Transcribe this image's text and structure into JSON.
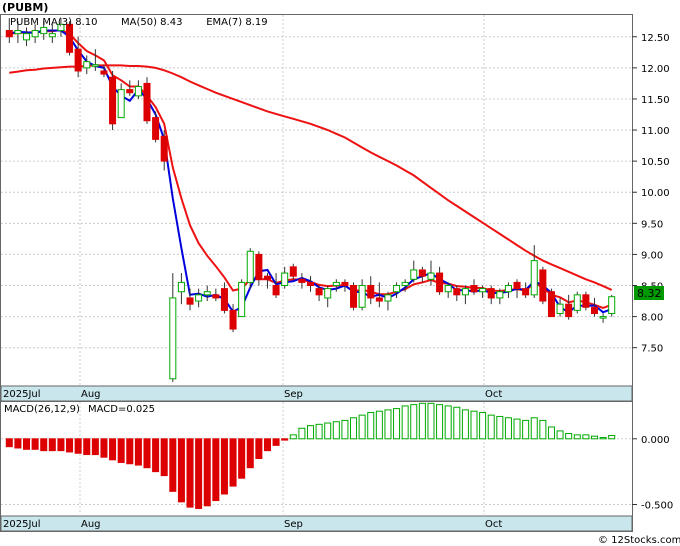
{
  "ticker_label": "(PUBM)",
  "indicators": [
    {
      "label": "PUBM",
      "color": "#0000cc"
    },
    {
      "label": "MA(3)",
      "value": "8.10",
      "color": "#0000cc"
    },
    {
      "label": "MA(50)",
      "value": "8.43",
      "color": "#0000cc"
    },
    {
      "label": "EMA(7)",
      "value": "8.19",
      "color": "#0000cc"
    }
  ],
  "last_price": "8.32",
  "macd_label": "MACD(26,12,9)",
  "macd_value_label": "MACD=0.025",
  "watermark": "© 12Stocks.com",
  "colors": {
    "up": "#00aa00",
    "down": "#dd0000",
    "ma_short": "#0000dd",
    "ma_long": "#ee1111",
    "axis_band": "#c8e6ec",
    "price_box": "#009900"
  },
  "chart_data": [
    {
      "type": "candlestick",
      "ylim": [
        6.9,
        12.85
      ],
      "yticks": [
        "12.50",
        "12.00",
        "11.50",
        "11.00",
        "10.50",
        "10.00",
        "9.50",
        "9.00",
        "8.50",
        "8.00",
        "7.50"
      ],
      "xticks": [
        "2025Jul",
        "Aug",
        "Sep",
        "Oct"
      ],
      "grid": true,
      "candles": [
        [
          12.6,
          12.8,
          12.4,
          12.5
        ],
        [
          12.55,
          12.75,
          12.4,
          12.6
        ],
        [
          12.45,
          12.65,
          12.35,
          12.55
        ],
        [
          12.5,
          12.7,
          12.4,
          12.6
        ],
        [
          12.55,
          12.75,
          12.45,
          12.65
        ],
        [
          12.5,
          12.7,
          12.4,
          12.55
        ],
        [
          12.6,
          12.8,
          12.5,
          12.7
        ],
        [
          12.7,
          12.75,
          12.2,
          12.25
        ],
        [
          12.3,
          12.5,
          11.85,
          11.95
        ],
        [
          12.0,
          12.2,
          11.9,
          12.1
        ],
        [
          12.05,
          12.3,
          11.95,
          12.05
        ],
        [
          11.95,
          12.05,
          11.85,
          11.9
        ],
        [
          11.85,
          11.95,
          11.0,
          11.1
        ],
        [
          11.2,
          11.75,
          11.2,
          11.65
        ],
        [
          11.65,
          11.8,
          11.55,
          11.6
        ],
        [
          11.55,
          11.8,
          11.5,
          11.7
        ],
        [
          11.75,
          11.85,
          11.1,
          11.15
        ],
        [
          11.2,
          11.3,
          10.8,
          10.85
        ],
        [
          10.9,
          11.0,
          10.35,
          10.5
        ],
        [
          7.0,
          8.7,
          6.95,
          8.3
        ],
        [
          8.4,
          8.7,
          8.2,
          8.55
        ],
        [
          8.3,
          8.45,
          8.1,
          8.2
        ],
        [
          8.25,
          8.45,
          8.15,
          8.35
        ],
        [
          8.35,
          8.5,
          8.25,
          8.4
        ],
        [
          8.35,
          8.45,
          8.25,
          8.3
        ],
        [
          8.45,
          8.55,
          8.05,
          8.1
        ],
        [
          8.1,
          8.2,
          7.75,
          7.8
        ],
        [
          8.0,
          8.6,
          8.0,
          8.55
        ],
        [
          8.55,
          9.1,
          8.45,
          9.05
        ],
        [
          9.0,
          9.05,
          8.5,
          8.6
        ],
        [
          8.65,
          8.7,
          8.45,
          8.6
        ],
        [
          8.5,
          8.7,
          8.3,
          8.35
        ],
        [
          8.5,
          8.8,
          8.45,
          8.7
        ],
        [
          8.8,
          8.85,
          8.6,
          8.65
        ],
        [
          8.6,
          8.7,
          8.45,
          8.55
        ],
        [
          8.55,
          8.65,
          8.4,
          8.5
        ],
        [
          8.45,
          8.5,
          8.25,
          8.35
        ],
        [
          8.3,
          8.5,
          8.15,
          8.45
        ],
        [
          8.5,
          8.6,
          8.4,
          8.55
        ],
        [
          8.55,
          8.6,
          8.4,
          8.5
        ],
        [
          8.5,
          8.55,
          8.1,
          8.15
        ],
        [
          8.15,
          8.6,
          8.1,
          8.5
        ],
        [
          8.5,
          8.65,
          8.2,
          8.3
        ],
        [
          8.3,
          8.55,
          8.15,
          8.25
        ],
        [
          8.25,
          8.4,
          8.1,
          8.35
        ],
        [
          8.4,
          8.55,
          8.3,
          8.5
        ],
        [
          8.5,
          8.6,
          8.4,
          8.55
        ],
        [
          8.6,
          8.9,
          8.55,
          8.75
        ],
        [
          8.75,
          8.8,
          8.55,
          8.65
        ],
        [
          8.6,
          8.9,
          8.5,
          8.7
        ],
        [
          8.7,
          8.8,
          8.35,
          8.4
        ],
        [
          8.4,
          8.55,
          8.3,
          8.5
        ],
        [
          8.45,
          8.5,
          8.25,
          8.35
        ],
        [
          8.35,
          8.5,
          8.2,
          8.45
        ],
        [
          8.5,
          8.6,
          8.35,
          8.4
        ],
        [
          8.4,
          8.5,
          8.3,
          8.45
        ],
        [
          8.45,
          8.5,
          8.2,
          8.3
        ],
        [
          8.3,
          8.45,
          8.2,
          8.4
        ],
        [
          8.4,
          8.55,
          8.3,
          8.5
        ],
        [
          8.55,
          8.6,
          8.3,
          8.45
        ],
        [
          8.45,
          8.55,
          8.3,
          8.35
        ],
        [
          8.35,
          9.15,
          8.3,
          8.9
        ],
        [
          8.75,
          8.8,
          8.2,
          8.25
        ],
        [
          8.4,
          8.45,
          8.0,
          8.0
        ],
        [
          8.05,
          8.3,
          8.0,
          8.2
        ],
        [
          8.2,
          8.35,
          7.95,
          8.0
        ],
        [
          8.1,
          8.4,
          8.05,
          8.35
        ],
        [
          8.35,
          8.4,
          8.1,
          8.15
        ],
        [
          8.15,
          8.3,
          8.0,
          8.05
        ],
        [
          8.0,
          8.05,
          7.9,
          8.0
        ],
        [
          8.05,
          8.35,
          8.0,
          8.32
        ]
      ],
      "ma_short": [
        12.55,
        12.58,
        12.57,
        12.56,
        12.6,
        12.6,
        12.6,
        12.5,
        12.28,
        12.1,
        12.03,
        12.0,
        11.7,
        11.55,
        11.47,
        11.65,
        11.5,
        11.25,
        10.85,
        9.9,
        9.1,
        8.35,
        8.37,
        8.32,
        8.35,
        8.28,
        8.08,
        8.15,
        8.47,
        8.73,
        8.75,
        8.52,
        8.55,
        8.57,
        8.62,
        8.57,
        8.47,
        8.43,
        8.45,
        8.5,
        8.4,
        8.39,
        8.32,
        8.35,
        8.3,
        8.37,
        8.47,
        8.6,
        8.65,
        8.7,
        8.6,
        8.53,
        8.42,
        8.43,
        8.4,
        8.43,
        8.38,
        8.38,
        8.4,
        8.45,
        8.43,
        8.57,
        8.5,
        8.38,
        8.15,
        8.07,
        8.18,
        8.17,
        8.18,
        8.07,
        8.12
      ],
      "ema_short": [
        12.55,
        12.56,
        12.57,
        12.57,
        12.59,
        12.59,
        12.61,
        12.55,
        12.4,
        12.27,
        12.2,
        12.12,
        11.88,
        11.8,
        11.7,
        11.7,
        11.55,
        11.37,
        11.1,
        10.4,
        9.9,
        9.47,
        9.18,
        8.98,
        8.81,
        8.63,
        8.42,
        8.45,
        8.6,
        8.6,
        8.6,
        8.54,
        8.58,
        8.6,
        8.59,
        8.56,
        8.51,
        8.49,
        8.5,
        8.5,
        8.41,
        8.43,
        8.4,
        8.36,
        8.36,
        8.4,
        8.44,
        8.52,
        8.55,
        8.59,
        8.54,
        8.53,
        8.49,
        8.48,
        8.46,
        8.46,
        8.42,
        8.41,
        8.43,
        8.44,
        8.42,
        8.54,
        8.47,
        8.35,
        8.31,
        8.23,
        8.26,
        8.23,
        8.19,
        8.14,
        8.19
      ],
      "ma_long": [
        11.92,
        11.94,
        11.96,
        11.97,
        11.99,
        12.0,
        12.01,
        12.02,
        12.02,
        12.03,
        12.04,
        12.04,
        12.04,
        12.04,
        12.03,
        12.03,
        12.02,
        12.0,
        11.96,
        11.91,
        11.85,
        11.78,
        11.72,
        11.66,
        11.6,
        11.55,
        11.5,
        11.45,
        11.4,
        11.35,
        11.3,
        11.26,
        11.22,
        11.18,
        11.14,
        11.1,
        11.05,
        11.0,
        10.94,
        10.88,
        10.8,
        10.72,
        10.64,
        10.57,
        10.5,
        10.43,
        10.35,
        10.27,
        10.17,
        10.07,
        9.97,
        9.87,
        9.78,
        9.69,
        9.6,
        9.51,
        9.42,
        9.33,
        9.24,
        9.15,
        9.06,
        8.98,
        8.9,
        8.84,
        8.78,
        8.72,
        8.66,
        8.6,
        8.55,
        8.49,
        8.43
      ]
    },
    {
      "type": "bar",
      "title": "MACD(26,12,9)",
      "ylim": [
        -0.58,
        0.28
      ],
      "yticks": [
        "0.000",
        "-0.500"
      ],
      "xticks": [
        "2025Jul",
        "Aug",
        "Sep",
        "Oct"
      ],
      "values": [
        -0.06,
        -0.07,
        -0.08,
        -0.08,
        -0.09,
        -0.09,
        -0.09,
        -0.1,
        -0.11,
        -0.12,
        -0.12,
        -0.14,
        -0.16,
        -0.18,
        -0.19,
        -0.2,
        -0.22,
        -0.25,
        -0.28,
        -0.4,
        -0.48,
        -0.52,
        -0.53,
        -0.51,
        -0.47,
        -0.42,
        -0.36,
        -0.3,
        -0.22,
        -0.15,
        -0.09,
        -0.05,
        -0.01,
        0.03,
        0.08,
        0.1,
        0.11,
        0.12,
        0.13,
        0.14,
        0.16,
        0.18,
        0.2,
        0.21,
        0.22,
        0.23,
        0.25,
        0.26,
        0.27,
        0.27,
        0.26,
        0.25,
        0.24,
        0.22,
        0.21,
        0.2,
        0.18,
        0.17,
        0.16,
        0.15,
        0.14,
        0.16,
        0.14,
        0.09,
        0.06,
        0.04,
        0.03,
        0.03,
        0.02,
        0.01,
        0.025
      ]
    }
  ]
}
